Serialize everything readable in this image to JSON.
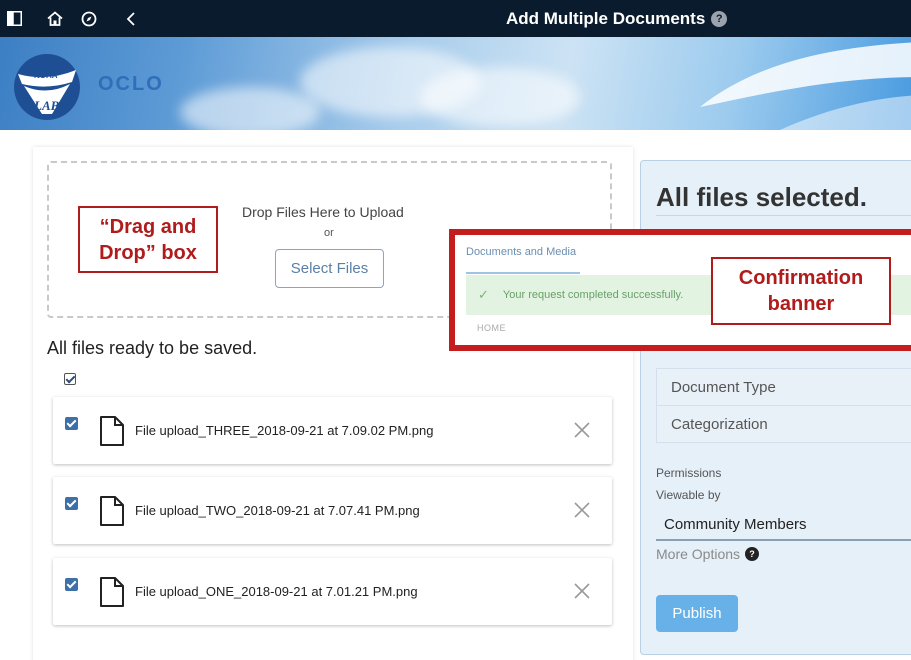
{
  "topbar": {
    "title": "Add Multiple Documents",
    "help_glyph": "?",
    "icons": [
      "sidebar-toggle-icon",
      "home-icon",
      "compass-icon",
      "chevron-left-icon"
    ]
  },
  "header": {
    "logo_text_top": "NOAA",
    "logo_text_bottom": "LAB",
    "brand": "OCLO"
  },
  "upload": {
    "drop_text": "Drop Files Here to Upload",
    "or_text": "or",
    "select_button": "Select Files",
    "ready_label": "All files ready to be saved."
  },
  "files": [
    {
      "name": "File upload_THREE_2018-09-21 at 7.09.02 PM.png"
    },
    {
      "name": "File upload_TWO_2018-09-21 at 7.07.41 PM.png"
    },
    {
      "name": "File upload_ONE_2018-09-21 at 7.01.21 PM.png"
    }
  ],
  "panel": {
    "title": "All files selected.",
    "document_type": "Document Type",
    "categorization": "Categorization",
    "permissions_label": "Permissions",
    "viewable_by_label": "Viewable by",
    "viewable_by_value": "Community Members",
    "more_options": "More Options",
    "more_options_help": "?",
    "publish_button": "Publish"
  },
  "confirmation": {
    "header": "Documents and Media",
    "success_icon": "✓",
    "message": "Your request completed successfully.",
    "breadcrumb": "HOME"
  },
  "callouts": {
    "drag_drop": "“Drag and\nDrop” box",
    "confirmation": "Confirmation\nbanner"
  },
  "colors": {
    "topbar": "#0b1b2e",
    "accent_blue": "#3d6fa8",
    "publish": "#67b1e8",
    "callout_red": "#c41d1d",
    "success_bg": "#e3f3e1"
  }
}
